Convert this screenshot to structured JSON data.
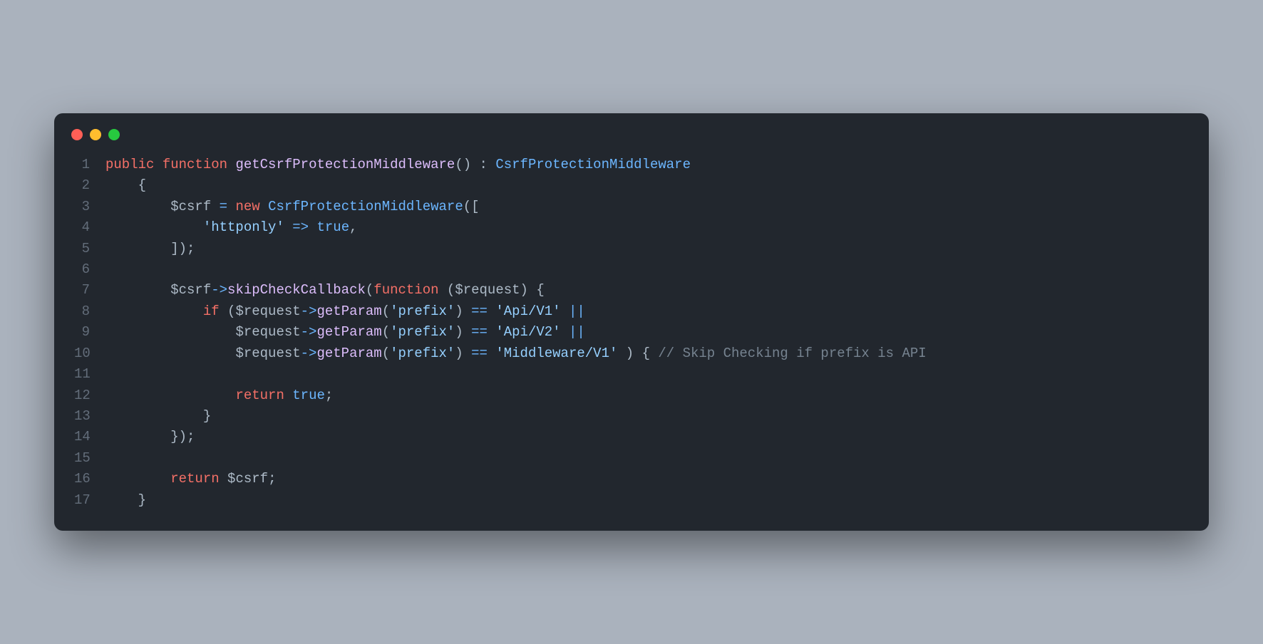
{
  "traffic_lights": {
    "red": "close",
    "yellow": "minimize",
    "green": "zoom"
  },
  "lines": {
    "1": {
      "num": "1",
      "t1": "public",
      "t2": "function",
      "t3": "getCsrfProtectionMiddleware",
      "t4": "()",
      "t5": " : ",
      "t6": "CsrfProtectionMiddleware"
    },
    "2": {
      "num": "2",
      "t1": "    {"
    },
    "3": {
      "num": "3",
      "t1": "        ",
      "t2": "$csrf",
      "t3": " ",
      "t4": "=",
      "t5": " ",
      "t6": "new",
      "t7": " ",
      "t8": "CsrfProtectionMiddleware",
      "t9": "(["
    },
    "4": {
      "num": "4",
      "t1": "            ",
      "t2": "'httponly'",
      "t3": " ",
      "t4": "=>",
      "t5": " ",
      "t6": "true",
      "t7": ","
    },
    "5": {
      "num": "5",
      "t1": "        ]);"
    },
    "6": {
      "num": "6",
      "t1": ""
    },
    "7": {
      "num": "7",
      "t1": "        ",
      "t2": "$csrf",
      "t3": "->",
      "t4": "skipCheckCallback",
      "t5": "(",
      "t6": "function",
      "t7": " (",
      "t8": "$request",
      "t9": ") {"
    },
    "8": {
      "num": "8",
      "t1": "            ",
      "t2": "if",
      "t3": " (",
      "t4": "$request",
      "t5": "->",
      "t6": "getParam",
      "t7": "(",
      "t8": "'prefix'",
      "t9": ") ",
      "t10": "==",
      "t11": " ",
      "t12": "'Api/V1'",
      "t13": " ",
      "t14": "||"
    },
    "9": {
      "num": "9",
      "t1": "                ",
      "t2": "$request",
      "t3": "->",
      "t4": "getParam",
      "t5": "(",
      "t6": "'prefix'",
      "t7": ") ",
      "t8": "==",
      "t9": " ",
      "t10": "'Api/V2'",
      "t11": " ",
      "t12": "||"
    },
    "10": {
      "num": "10",
      "t1": "                ",
      "t2": "$request",
      "t3": "->",
      "t4": "getParam",
      "t5": "(",
      "t6": "'prefix'",
      "t7": ") ",
      "t8": "==",
      "t9": " ",
      "t10": "'Middleware/V1'",
      "t11": " ) { ",
      "t12": "// Skip Checking if prefix is API"
    },
    "11": {
      "num": "11",
      "t1": ""
    },
    "12": {
      "num": "12",
      "t1": "                ",
      "t2": "return",
      "t3": " ",
      "t4": "true",
      "t5": ";"
    },
    "13": {
      "num": "13",
      "t1": "            }"
    },
    "14": {
      "num": "14",
      "t1": "        });"
    },
    "15": {
      "num": "15",
      "t1": ""
    },
    "16": {
      "num": "16",
      "t1": "        ",
      "t2": "return",
      "t3": " ",
      "t4": "$csrf",
      "t5": ";"
    },
    "17": {
      "num": "17",
      "t1": "    }"
    }
  }
}
